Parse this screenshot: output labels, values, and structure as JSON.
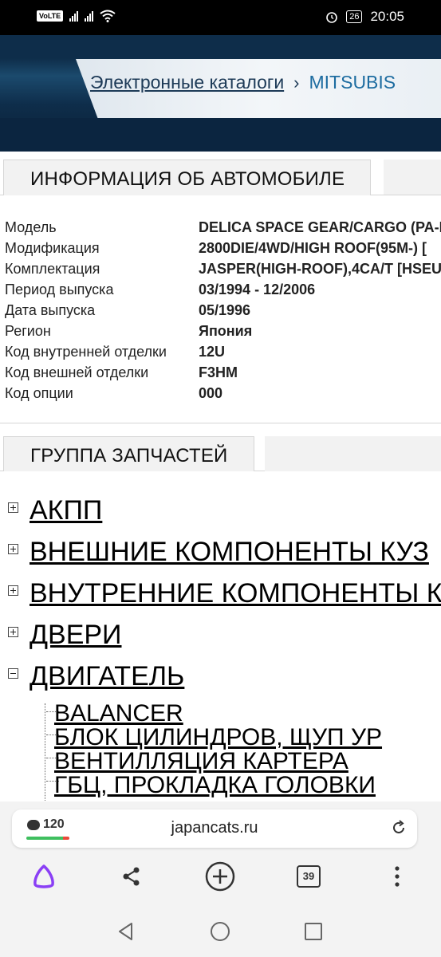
{
  "status_bar": {
    "volte": "VoLTE",
    "battery": "26",
    "time": "20:05"
  },
  "breadcrumb": {
    "link": "Электронные каталоги",
    "separator": "›",
    "current": "MITSUBIS"
  },
  "vehicle_info": {
    "title": "ИНФОРМАЦИЯ ОБ АВТОМОБИЛЕ",
    "rows": [
      {
        "label": "Модель",
        "value": "DELICA SPACE GEAR/CARGO (PA-I"
      },
      {
        "label": "Модификация",
        "value": "2800DIE/4WD/HIGH ROOF(95M-) ["
      },
      {
        "label": "Комплектация",
        "value": "JASPER(HIGH-ROOF),4CA/T [HSEU"
      },
      {
        "label": "Период выпуска",
        "value": "03/1994 - 12/2006"
      },
      {
        "label": "Дата выпуска",
        "value": "05/1996"
      },
      {
        "label": "Регион",
        "value": "Япония"
      },
      {
        "label": "Код внутренней отделки",
        "value": "12U"
      },
      {
        "label": "Код внешней отделки",
        "value": "F3HM"
      },
      {
        "label": "Код опции",
        "value": "000"
      }
    ]
  },
  "parts_group": {
    "title": "ГРУППА ЗАПЧАСТЕЙ",
    "items": [
      {
        "label": "АКПП",
        "expanded": false
      },
      {
        "label": "ВНЕШНИЕ КОМПОНЕНТЫ КУЗ",
        "expanded": false
      },
      {
        "label": "ВНУТРЕННИЕ КОМПОНЕНТЫ К",
        "expanded": false
      },
      {
        "label": "ДВЕРИ",
        "expanded": false
      },
      {
        "label": "ДВИГАТЕЛЬ",
        "expanded": true
      }
    ],
    "engine_children": [
      "BALANCER",
      "БЛОК ЦИЛИНДРОВ, ЩУП УР",
      "ВЕНТИЛЛЯЦИЯ КАРТЕРА",
      "ГБЦ, ПРОКЛАДКА ГОЛОВКИ"
    ]
  },
  "browser": {
    "comments_count": "120",
    "url": "japancats.ru",
    "tabs_count": "39",
    "colors": {
      "comment_bar_green": "#3fbf5f",
      "comment_bar_red": "#e84a3a",
      "alice_purple": "#8a3ff5"
    }
  }
}
